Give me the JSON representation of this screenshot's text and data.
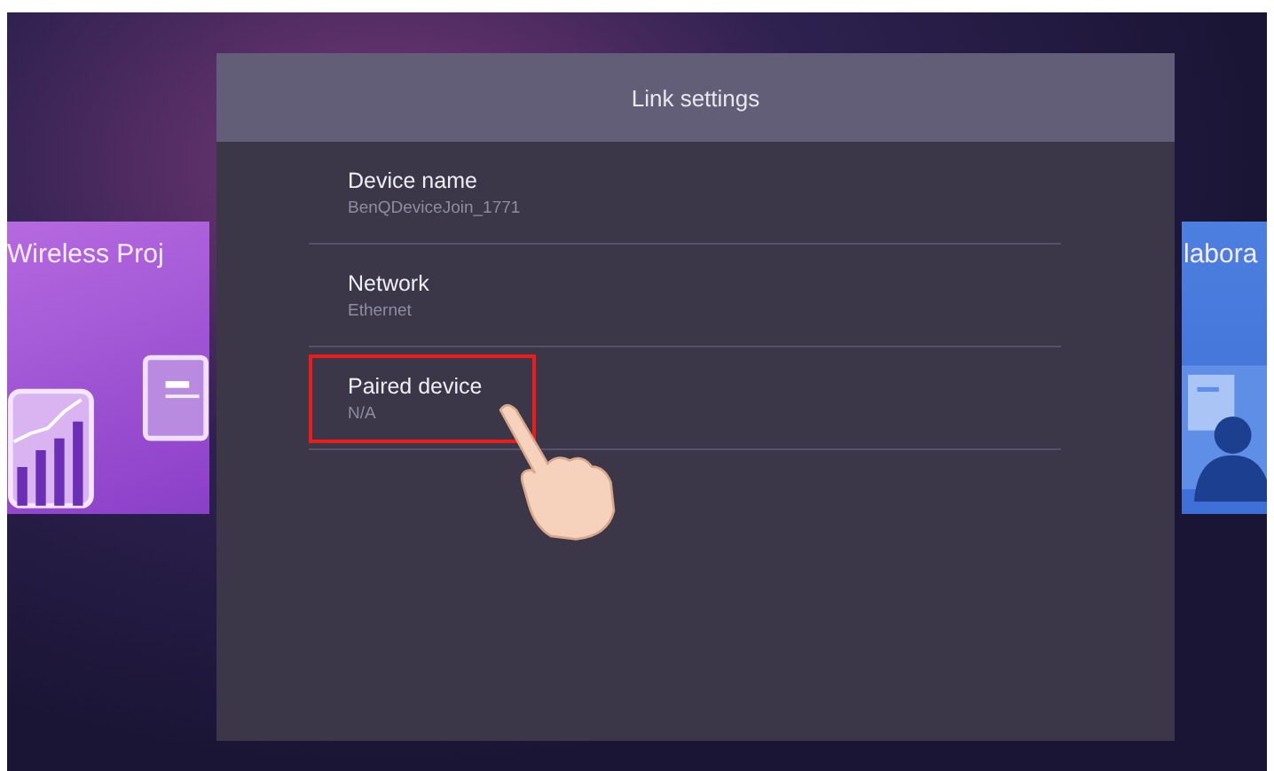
{
  "background_cards": [
    {
      "title": "Wireless Proj",
      "kind": "chart"
    },
    {
      "title": "labora",
      "kind": "person"
    }
  ],
  "dialog": {
    "title": "Link settings",
    "items": [
      {
        "label": "Device name",
        "value": "BenQDeviceJoin_1771",
        "highlighted": false
      },
      {
        "label": "Network",
        "value": "Ethernet",
        "highlighted": false
      },
      {
        "label": "Paired device",
        "value": "N/A",
        "highlighted": true
      }
    ]
  }
}
